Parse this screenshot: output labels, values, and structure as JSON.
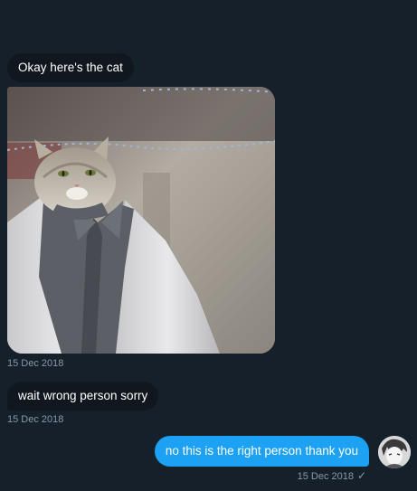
{
  "messages": [
    {
      "text": "Okay here's the cat",
      "direction": "received"
    },
    {
      "text": "wait wrong person sorry",
      "direction": "received",
      "timestamp": "15 Dec 2018"
    },
    {
      "text": "no this is the right person thank you",
      "direction": "sent",
      "timestamp": "15 Dec 2018",
      "status": "✓"
    }
  ],
  "photo": {
    "timestamp": "15 Dec 2018",
    "subject": "cat head on a person wearing a white suit jacket and dark shirt"
  },
  "avatar": {
    "icon": "user-avatar"
  },
  "colors": {
    "background": "#15202b",
    "received_bubble": "#10171e",
    "sent_bubble": "#1da1f2",
    "timestamp": "#8899a6"
  }
}
